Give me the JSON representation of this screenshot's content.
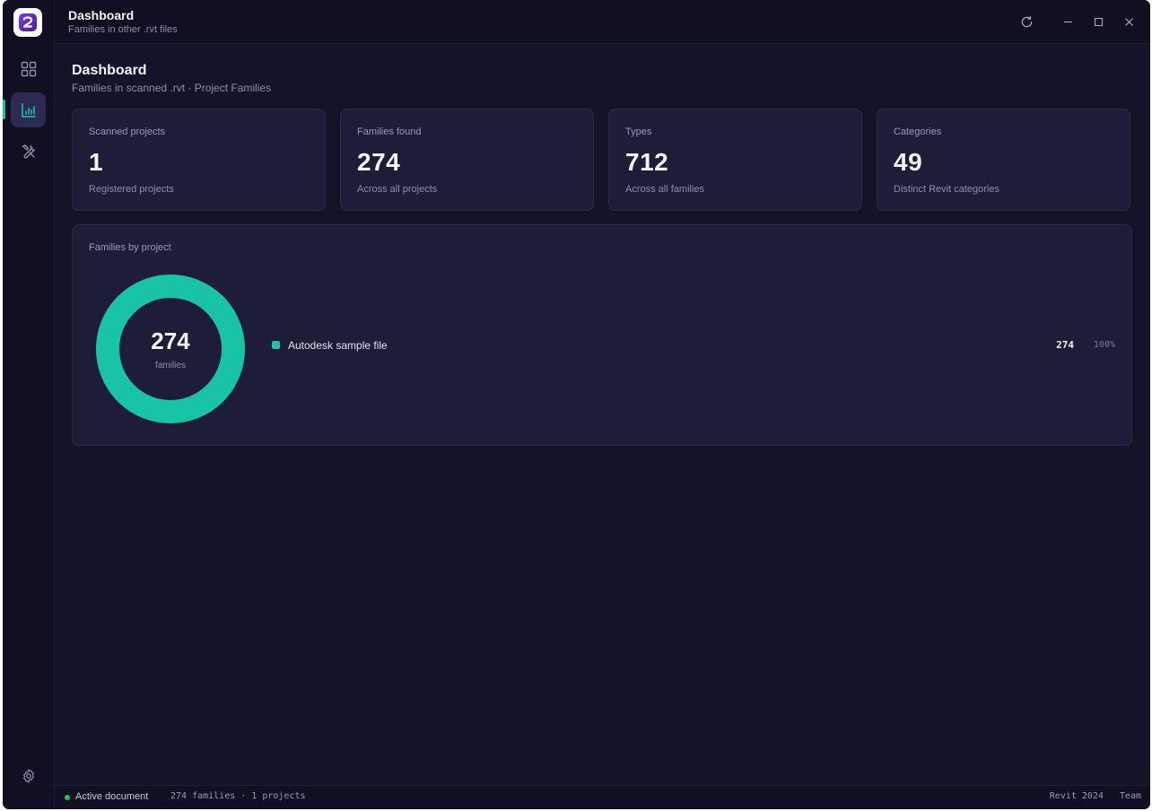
{
  "app": {
    "logo_icon": "app-logo-icon",
    "accent_color": "#19c4a4"
  },
  "titlebar": {
    "title": "Dashboard",
    "subtitle": "Families in other .rvt files"
  },
  "sidebar": {
    "items": [
      {
        "name": "grid-icon",
        "active": false
      },
      {
        "name": "chart-icon",
        "active": true
      },
      {
        "name": "tools-icon",
        "active": false
      }
    ],
    "settings_icon": "gear-icon"
  },
  "page": {
    "title": "Dashboard",
    "subtitle": "Families in scanned .rvt · Project Families"
  },
  "stats": [
    {
      "label": "Scanned projects",
      "value": "1",
      "note": "Registered projects"
    },
    {
      "label": "Families found",
      "value": "274",
      "note": "Across all projects"
    },
    {
      "label": "Types",
      "value": "712",
      "note": "Across all families"
    },
    {
      "label": "Categories",
      "value": "49",
      "note": "Distinct Revit categories"
    }
  ],
  "chart": {
    "title": "Families by project",
    "center_value": "274",
    "center_label": "families"
  },
  "chart_data": {
    "type": "pie",
    "title": "Families by project",
    "categories": [
      "Autodesk sample file"
    ],
    "values": [
      274
    ],
    "percent_labels": [
      "100%"
    ],
    "value_labels": [
      "274"
    ],
    "colors": [
      "#19c4a4"
    ],
    "donut": true
  },
  "statusbar": {
    "active_label": "Active document",
    "summary": "274 families · 1 projects",
    "version": "Revit 2024",
    "edition": "Team"
  }
}
